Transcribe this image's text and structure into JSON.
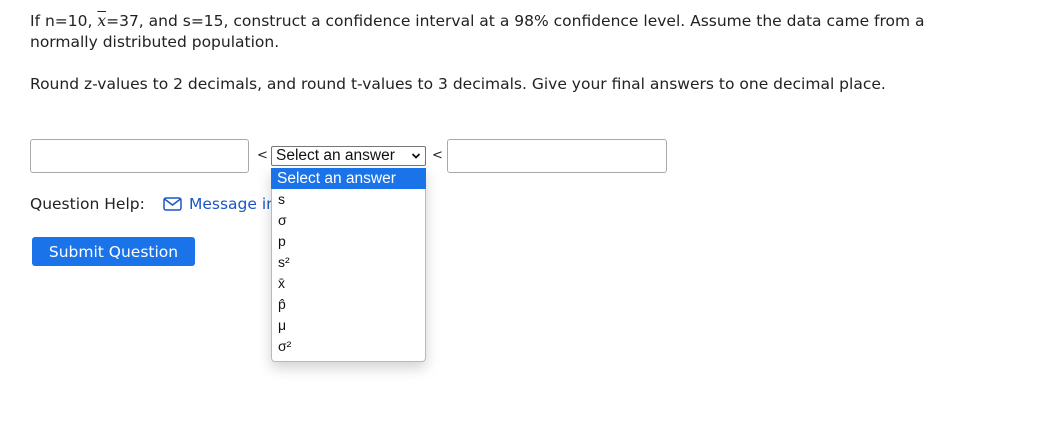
{
  "question": {
    "line1_a": "If n=10, ",
    "xbar_symbol": "x",
    "line1_b": "=37, and s=15, construct a confidence interval at a 98% confidence level. Assume the data came from a normally distributed population.",
    "instructions": "Round z-values to 2 decimals, and round t-values to 3 decimals. Give your final answers to one decimal place."
  },
  "interval": {
    "lower_value": "",
    "upper_value": "",
    "less_than_left": "<",
    "less_than_right": "<",
    "select_selected": "Select an answer",
    "dropdown_options": [
      "Select an answer",
      "s",
      "σ",
      "p",
      "s²",
      "x̄",
      "p̂",
      "μ",
      "σ²"
    ]
  },
  "help": {
    "label": "Question Help:",
    "icon": "envelope-icon",
    "message_text": "Message instructor"
  },
  "submit_label": "Submit Question",
  "colors": {
    "accent": "#1a73e8",
    "link": "#1a57c6"
  }
}
